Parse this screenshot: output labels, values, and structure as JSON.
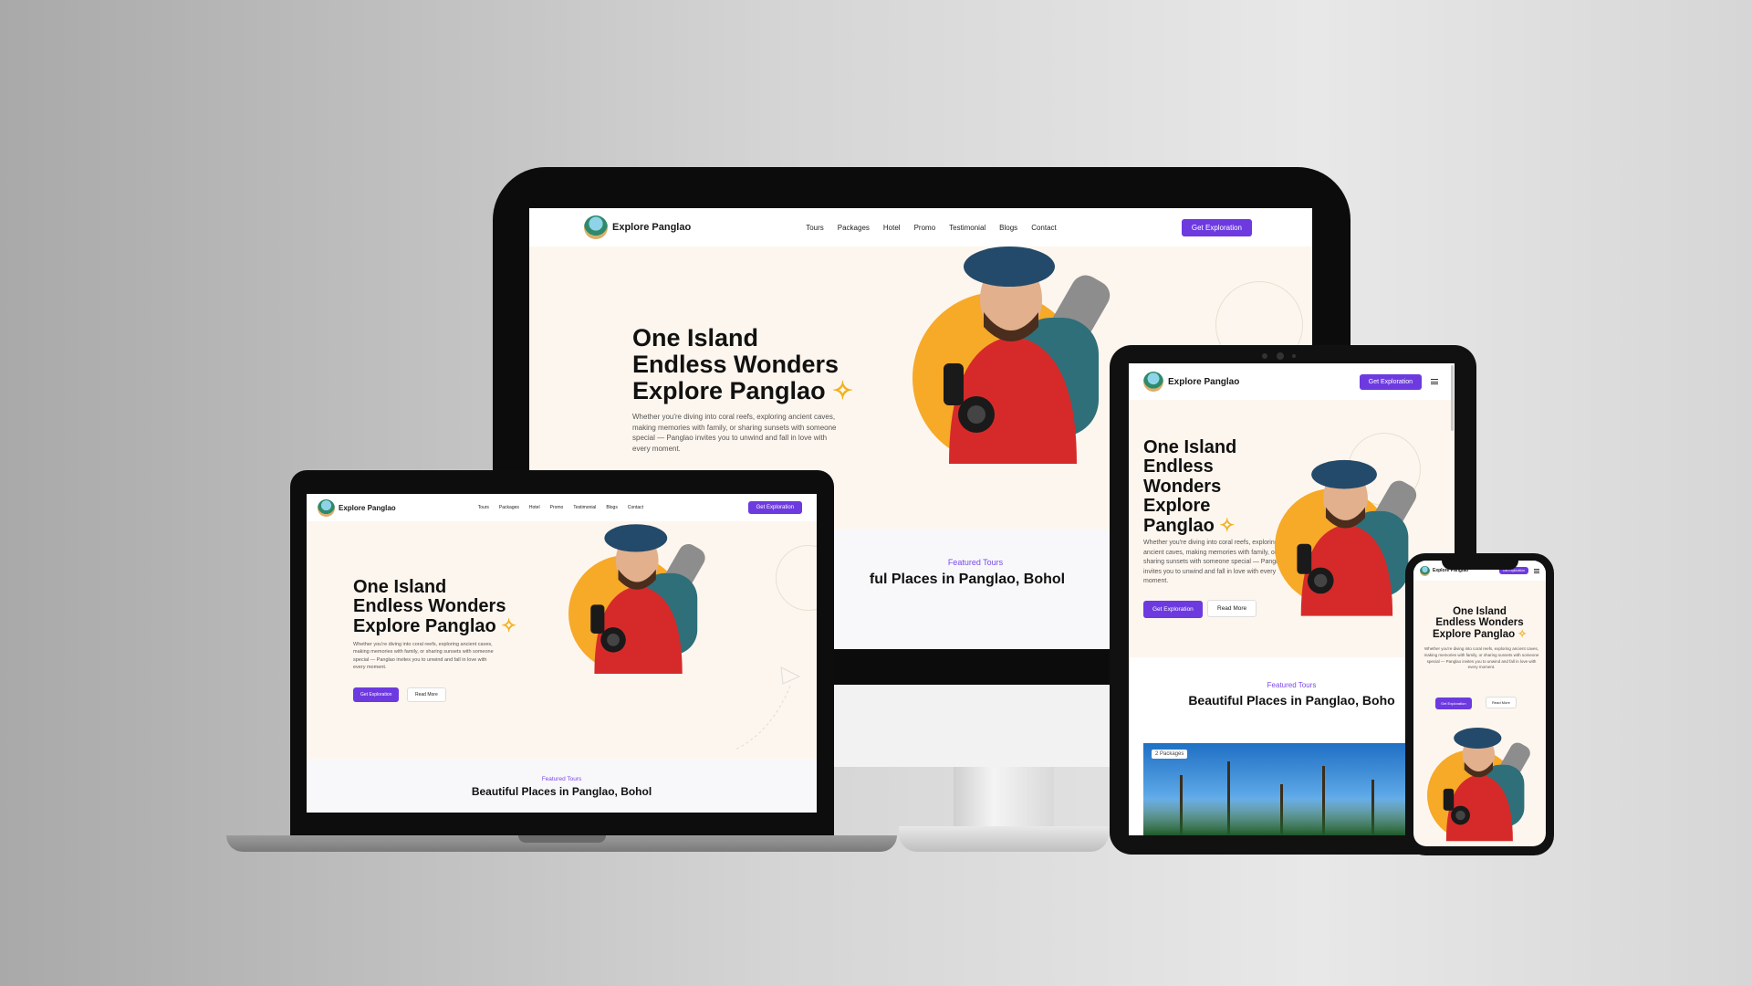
{
  "site": {
    "brand": "Explore Panglao",
    "nav_links": [
      "Tours",
      "Packages",
      "Hotel",
      "Promo",
      "Testimonial",
      "Blogs",
      "Contact"
    ],
    "cta_label": "Get Exploration",
    "hero": {
      "line1": "One Island",
      "line2": "Endless Wonders",
      "line2a": "Endless",
      "line2b": "Wonders",
      "line3": "Explore Panglao",
      "line3a": "Explore",
      "line3b": "Panglao",
      "sparkle": "✧",
      "paragraph": "Whether you're diving into coral reefs, exploring ancient caves, making memories with family, or sharing sunsets with someone special — Panglao invites you to unwind and fall in love with every moment.",
      "primary_button": "Get Exploration",
      "secondary_button": "Read More"
    },
    "featured": {
      "tag": "Featured Tours",
      "title": "Beautiful Places in Panglao, Bohol",
      "title_partial_desktop": "ful Places in Panglao, Bohol",
      "title_partial_tablet": "Beautiful Places in Panglao, Boho"
    },
    "package_badge": "2 Packages"
  },
  "icons": {
    "logo": "island-logo-icon",
    "menu": "hamburger-menu-icon",
    "sparkle": "sparkle-star-icon",
    "plane": "paper-plane-icon"
  },
  "colors": {
    "accent": "#6d3ae0",
    "hero_bg": "#fdf6ee",
    "highlight": "#f7a928",
    "featured_tag": "#7a48e6"
  }
}
